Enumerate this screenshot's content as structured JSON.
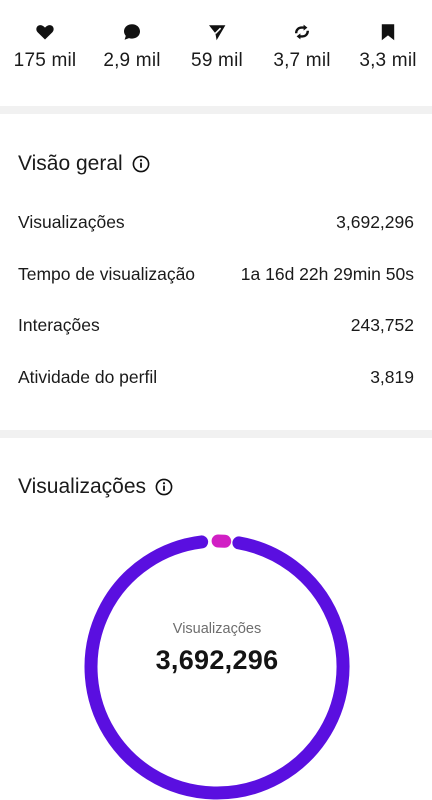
{
  "engagement_stats": [
    {
      "icon": "heart-icon",
      "value": "175 mil"
    },
    {
      "icon": "comment-icon",
      "value": "2,9 mil"
    },
    {
      "icon": "share-icon",
      "value": "59 mil"
    },
    {
      "icon": "repost-icon",
      "value": "3,7 mil"
    },
    {
      "icon": "bookmark-icon",
      "value": "3,3 mil"
    }
  ],
  "overview": {
    "title": "Visão geral",
    "rows": [
      {
        "label": "Visualizações",
        "value": "3,692,296"
      },
      {
        "label": "Tempo de visualização",
        "value": "1a 16d 22h 29min 50s"
      },
      {
        "label": "Interações",
        "value": "243,752"
      },
      {
        "label": "Atividade do perfil",
        "value": "3,819"
      }
    ]
  },
  "views_section": {
    "title": "Visualizações",
    "donut_label": "Visualizações",
    "donut_value": "3,692,296"
  },
  "colors": {
    "donut_main": "#5a0fe0",
    "donut_accent": "#d11fc4",
    "divider": "#f1f1f1"
  }
}
